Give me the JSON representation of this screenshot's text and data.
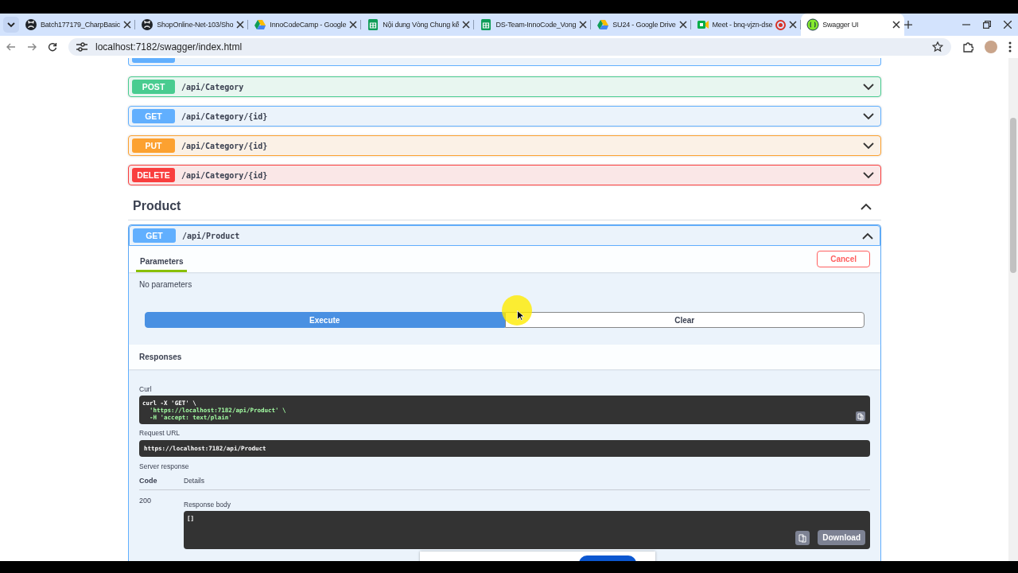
{
  "browser": {
    "tabs": [
      {
        "title": "Batch177179_CharpBasic",
        "kind": "github",
        "recording": false,
        "selected": false
      },
      {
        "title": "ShopOnline-Net-103/Sho",
        "kind": "github",
        "recording": false,
        "selected": false
      },
      {
        "title": "InnoCodeCamp - Google",
        "kind": "drive",
        "recording": false,
        "selected": false
      },
      {
        "title": "Nội dung Vòng Chung kế",
        "kind": "sheets",
        "recording": false,
        "selected": false
      },
      {
        "title": "DS-Team-InnoCode_Vong",
        "kind": "sheets",
        "recording": false,
        "selected": false
      },
      {
        "title": "SU24 - Google Drive",
        "kind": "drive",
        "recording": false,
        "selected": false
      },
      {
        "title": "Meet - bnq-vjzn-dse",
        "kind": "meet",
        "recording": true,
        "selected": false
      },
      {
        "title": "Swagger UI",
        "kind": "swagger",
        "recording": false,
        "selected": true
      }
    ],
    "url": "localhost:7182/swagger/index.html"
  },
  "operations": [
    {
      "method": "POST",
      "path": "/api/Category"
    },
    {
      "method": "GET",
      "path": "/api/Category/{id}"
    },
    {
      "method": "PUT",
      "path": "/api/Category/{id}"
    },
    {
      "method": "DELETE",
      "path": "/api/Category/{id}"
    }
  ],
  "section": {
    "title": "Product",
    "expanded": true
  },
  "opblock": {
    "method": "GET",
    "path": "/api/Product",
    "expanded": true,
    "tab": "Parameters",
    "cancel": "Cancel",
    "no_params": "No parameters",
    "execute": "Execute",
    "clear": "Clear",
    "responses_title": "Responses",
    "curl_label": "Curl",
    "curl_lines": [
      "curl -X 'GET' \\",
      "  'https://localhost:7182/api/Product' \\",
      "  -H 'accept: text/plain'"
    ],
    "request_url_label": "Request URL",
    "request_url": "https://localhost:7182/api/Product",
    "server_response_label": "Server response",
    "code_header": "Code",
    "details_header": "Details",
    "code": "200",
    "response_body_label": "Response body",
    "response_body": "[]",
    "download": "Download"
  }
}
